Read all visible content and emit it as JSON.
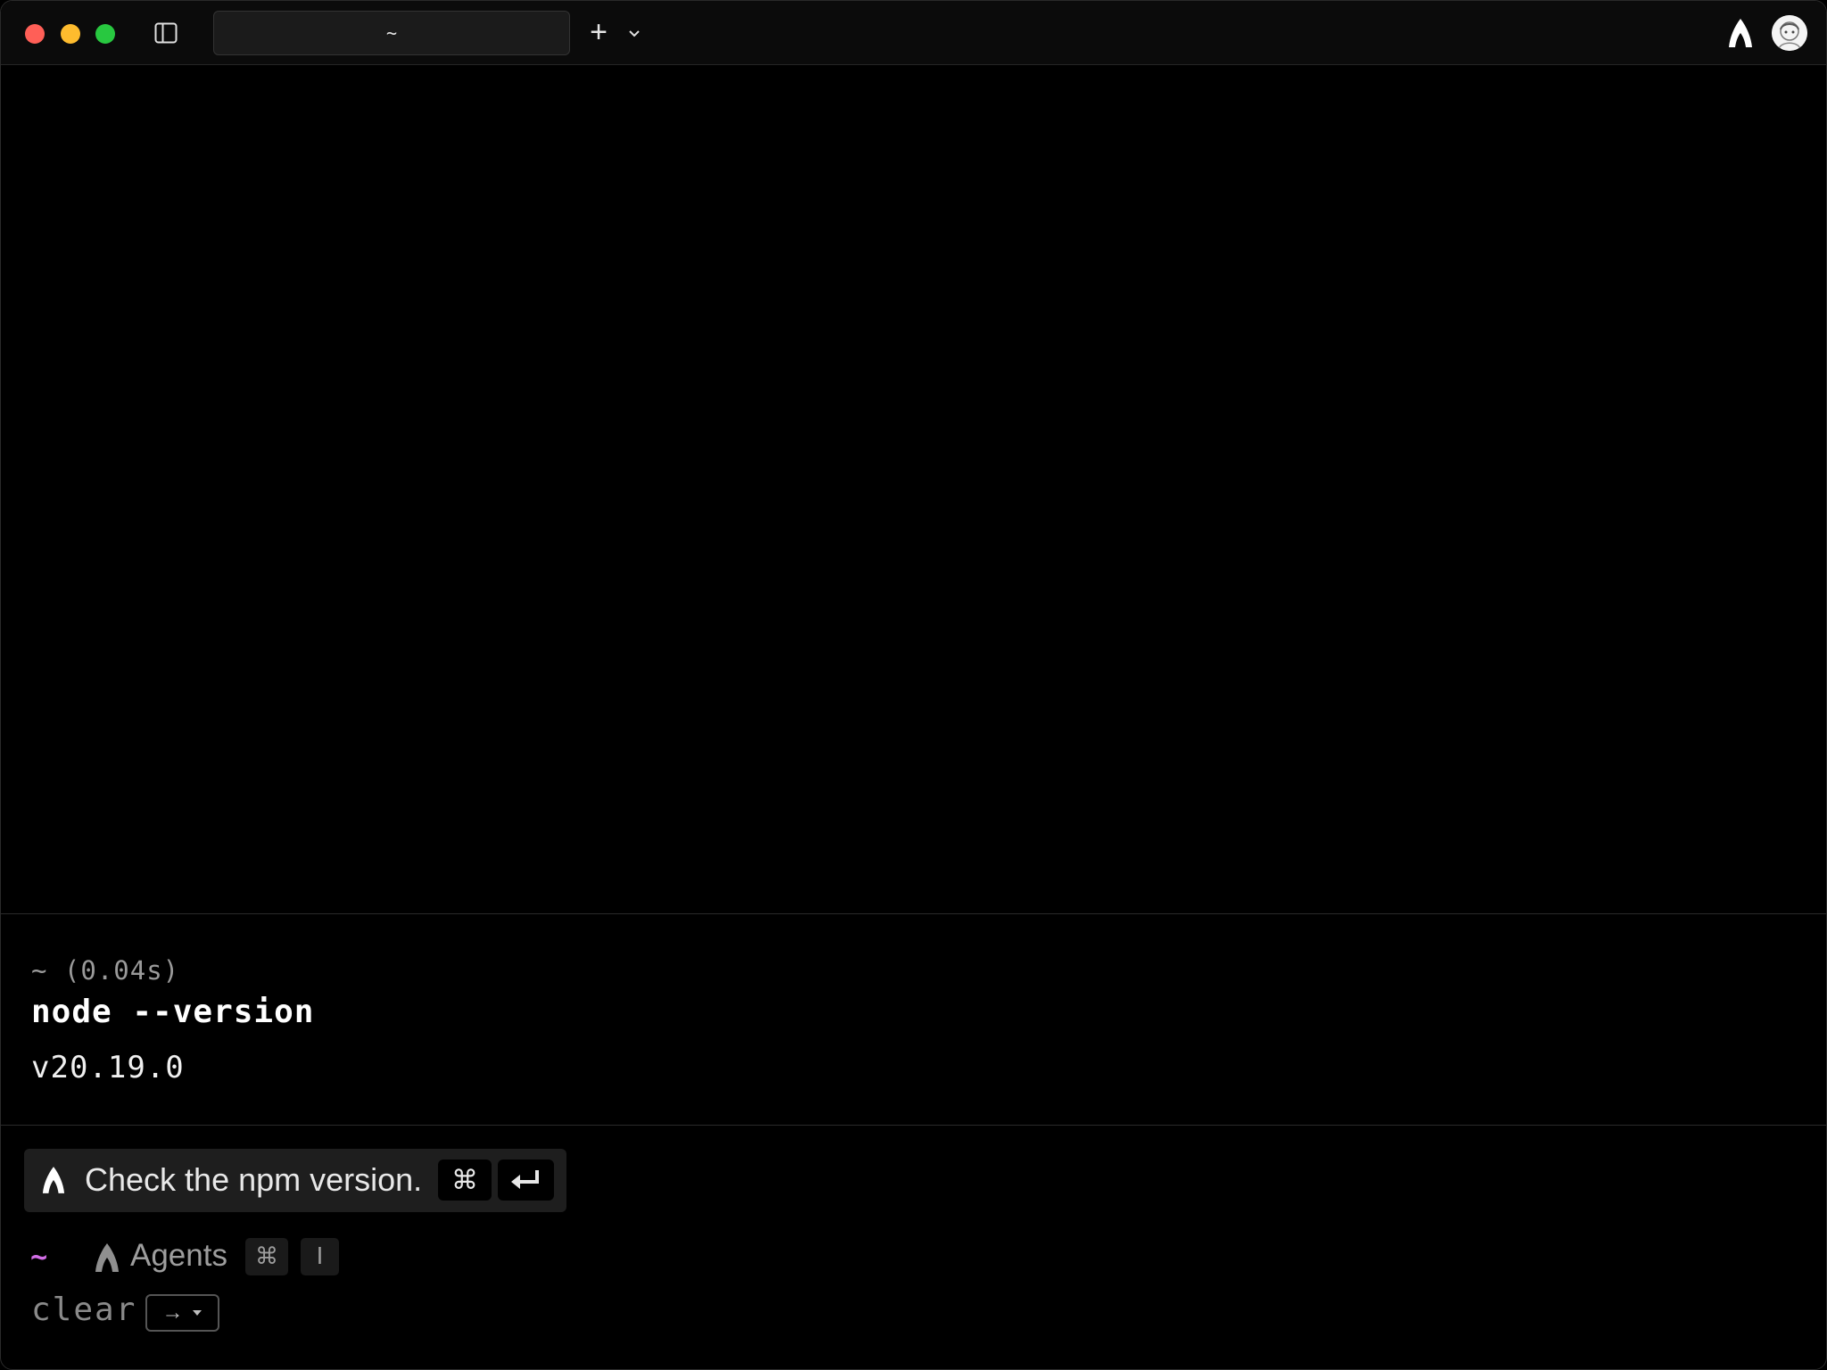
{
  "tab": {
    "title": "~"
  },
  "toolbar": {
    "new_tab_symbol": "+"
  },
  "terminal": {
    "block": {
      "meta": "~ (0.04s)",
      "command": "node --version",
      "output": "v20.19.0"
    }
  },
  "suggestion": {
    "text": "Check the npm version.",
    "shortcut_cmd": "⌘"
  },
  "prompt": {
    "cwd": "~",
    "agents_label": "Agents",
    "shortcut_cmd": "⌘",
    "shortcut_key": "I"
  },
  "input": {
    "value": "clear",
    "accept_arrow": "→"
  },
  "colors": {
    "prompt_accent": "#d26ee6",
    "close": "#ff5f57",
    "minimize": "#febc2e",
    "maximize": "#28c840"
  }
}
